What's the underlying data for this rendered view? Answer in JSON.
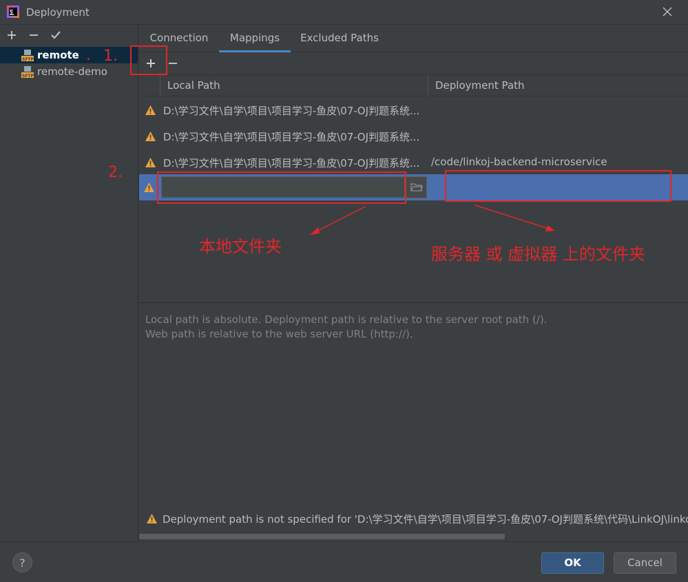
{
  "window": {
    "title": "Deployment"
  },
  "servers": [
    {
      "label": "remote",
      "selected": true
    },
    {
      "label": "remote-demo",
      "selected": false
    }
  ],
  "tabs": [
    {
      "label": "Connection",
      "active": false
    },
    {
      "label": "Mappings",
      "active": true
    },
    {
      "label": "Excluded Paths",
      "active": false
    }
  ],
  "table": {
    "columns": [
      "Local Path",
      "Deployment Path"
    ],
    "rows": [
      {
        "local": "D:\\学习文件\\自学\\项目\\项目学习-鱼皮\\07-OJ判题系统...",
        "deploy": ""
      },
      {
        "local": "D:\\学习文件\\自学\\项目\\项目学习-鱼皮\\07-OJ判题系统...",
        "deploy": ""
      },
      {
        "local": "D:\\学习文件\\自学\\项目\\项目学习-鱼皮\\07-OJ判题系统...",
        "deploy": "/code/linkoj-backend-microservice"
      }
    ]
  },
  "help_lines": [
    "Local path is absolute. Deployment path is relative to the server root path (/).",
    "Web path is relative to the web server URL (http://)."
  ],
  "bottom_warning": "Deployment path is not specified for 'D:\\学习文件\\自学\\项目\\项目学习-鱼皮\\07-OJ判题系统\\代码\\LinkOJ\\linkoj",
  "buttons": {
    "ok": "OK",
    "cancel": "Cancel",
    "help": "?"
  },
  "annotations": {
    "step1": "1.",
    "step1_dot": ".",
    "step2": "2.",
    "local_folder": "本地文件夹",
    "server_folder": "服务器 或 虚拟器 上的文件夹"
  },
  "colors": {
    "annotation_red": "#e0272a",
    "selection_blue": "#4b6eaf",
    "warning_yellow": "#e8a33d"
  }
}
